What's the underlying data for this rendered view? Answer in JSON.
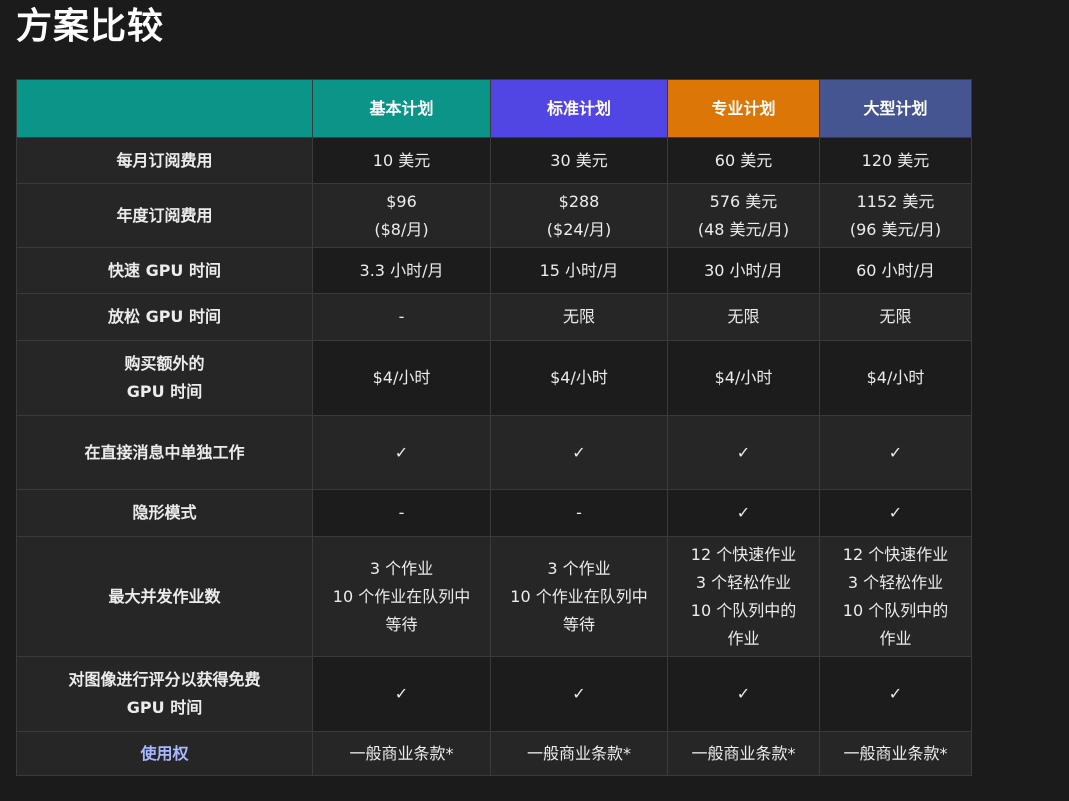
{
  "page": {
    "title": "方案比较"
  },
  "plans": [
    "基本计划",
    "标准计划",
    "专业计划",
    "大型计划"
  ],
  "rows": [
    {
      "label": "每月订阅费用",
      "values": [
        "10 美元",
        "30 美元",
        "60 美元",
        "120 美元"
      ]
    },
    {
      "label": "年度订阅费用",
      "values": [
        "$96\n($8/月)",
        "$288\n($24/月)",
        "576 美元\n(48 美元/月)",
        "1152 美元\n(96 美元/月)"
      ]
    },
    {
      "label": "快速 GPU 时间",
      "values": [
        "3.3 小时/月",
        "15 小时/月",
        "30 小时/月",
        "60 小时/月"
      ]
    },
    {
      "label": "放松 GPU 时间",
      "values": [
        "-",
        "无限",
        "无限",
        "无限"
      ]
    },
    {
      "label": "购买额外的\nGPU 时间",
      "values": [
        "$4/小时",
        "$4/小时",
        "$4/小时",
        "$4/小时"
      ]
    },
    {
      "label": "在直接消息中单独工作",
      "values": [
        "✓",
        "✓",
        "✓",
        "✓"
      ]
    },
    {
      "label": "隐形模式",
      "values": [
        "-",
        "-",
        "✓",
        "✓"
      ]
    },
    {
      "label": "最大并发作业数",
      "values": [
        "3 个作业\n10 个作业在队列中\n等待",
        "3 个作业\n10 个作业在队列中\n等待",
        "12 个快速作业\n3 个轻松作业\n10 个队列中的\n作业",
        "12 个快速作业\n3 个轻松作业\n10 个队列中的\n作业"
      ]
    },
    {
      "label": "对图像进行评分以获得免费\nGPU 时间",
      "values": [
        "✓",
        "✓",
        "✓",
        "✓"
      ]
    },
    {
      "label": "使用权",
      "values": [
        "一般商业条款*",
        "一般商业条款*",
        "一般商业条款*",
        "一般商业条款*"
      ]
    }
  ]
}
